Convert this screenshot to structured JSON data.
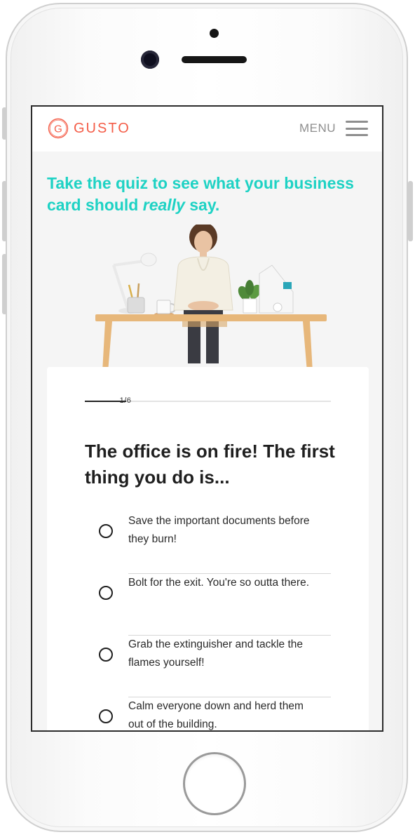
{
  "brand": {
    "name": "GUSTO",
    "logo_letter": "G",
    "accent_color": "#f45d48",
    "headline_color": "#1ed2c4"
  },
  "nav": {
    "menu_label": "MENU",
    "menu_icon": "hamburger-icon"
  },
  "hero": {
    "headline_part1": "Take the quiz to see what your business card should ",
    "headline_emphasis": "really",
    "headline_part2": " say.",
    "image": "woman-at-desk-illustration"
  },
  "quiz": {
    "progress_label": "1/6",
    "progress": {
      "current": 1,
      "total": 6
    },
    "question": "The office is on fire! The first thing you do is...",
    "options": [
      {
        "label": "Save the important documents before they burn!",
        "selected": false
      },
      {
        "label": "Bolt for the exit. You're so outta there.",
        "selected": false
      },
      {
        "label": "Grab the extinguisher and tackle the flames yourself!",
        "selected": false
      },
      {
        "label": "Calm everyone down and herd them out of the building.",
        "selected": false
      }
    ]
  }
}
